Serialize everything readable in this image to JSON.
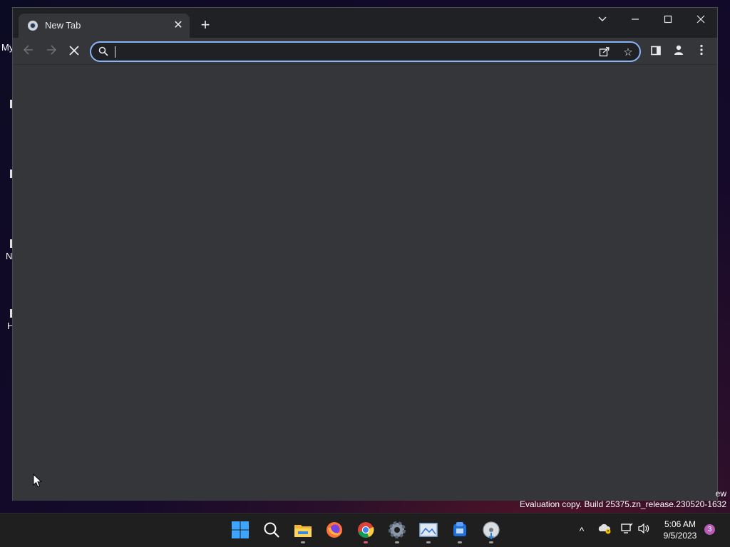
{
  "desktop": {
    "fragments": [
      "My",
      "N",
      "H"
    ]
  },
  "browser": {
    "tab": {
      "title": "New Tab",
      "close_icon": "close-icon",
      "favicon": "chrome-newtab-icon"
    },
    "new_tab_label": "+",
    "window_controls": {
      "tab_search": "chevron-down-icon",
      "minimize": "minimize-icon",
      "maximize": "maximize-icon",
      "close": "close-icon"
    },
    "toolbar": {
      "back": "back-arrow-icon",
      "forward": "forward-arrow-icon",
      "stop": "stop-loading-icon",
      "omnibox": {
        "value": "",
        "search_icon": "search-icon"
      },
      "share": "share-icon",
      "bookmark": "star-icon",
      "side_panel": "side-panel-icon",
      "profile": "profile-icon",
      "menu": "kebab-menu-icon"
    },
    "colors": {
      "frame": "#202124",
      "toolbar": "#35363a",
      "accent": "#8ab4f8"
    }
  },
  "watermark": {
    "fragment": "ew",
    "text": "Evaluation copy. Build 25375.zn_release.230520-1632"
  },
  "taskbar": {
    "apps": [
      "start-windows-icon",
      "search-icon",
      "file-explorer-icon",
      "firefox-icon",
      "chrome-icon",
      "settings-gear-icon",
      "photos-icon",
      "blue-app-icon",
      "installer-disc-icon"
    ],
    "tray": {
      "chevron": "^",
      "notification_count": "3"
    },
    "clock": {
      "time": "5:06 AM",
      "date": "9/5/2023"
    }
  }
}
